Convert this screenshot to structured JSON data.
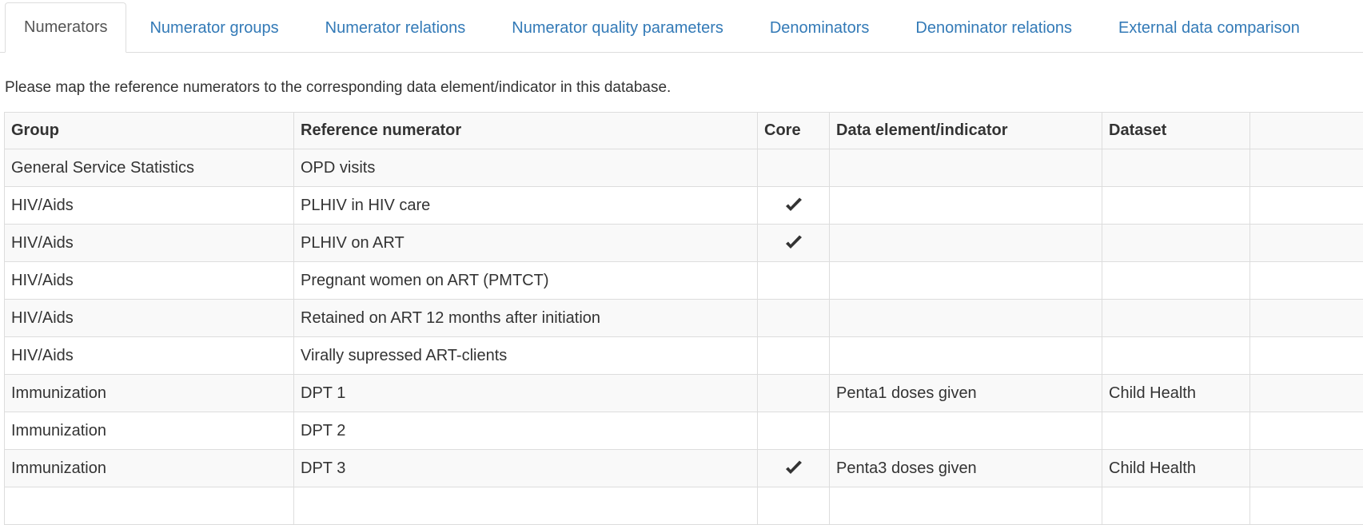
{
  "tabs": [
    {
      "label": "Numerators",
      "active": true
    },
    {
      "label": "Numerator groups",
      "active": false
    },
    {
      "label": "Numerator relations",
      "active": false
    },
    {
      "label": "Numerator quality parameters",
      "active": false
    },
    {
      "label": "Denominators",
      "active": false
    },
    {
      "label": "Denominator relations",
      "active": false
    },
    {
      "label": "External data comparison",
      "active": false
    }
  ],
  "instructions": "Please map the reference numerators to the corresponding data element/indicator in this database.",
  "table": {
    "headers": {
      "group": "Group",
      "reference": "Reference numerator",
      "core": "Core",
      "data_element": "Data element/indicator",
      "dataset": "Dataset"
    },
    "rows": [
      {
        "group": "General Service Statistics",
        "reference": "OPD visits",
        "core": false,
        "data_element": "",
        "dataset": ""
      },
      {
        "group": "HIV/Aids",
        "reference": "PLHIV in HIV care",
        "core": true,
        "data_element": "",
        "dataset": ""
      },
      {
        "group": "HIV/Aids",
        "reference": "PLHIV on ART",
        "core": true,
        "data_element": "",
        "dataset": ""
      },
      {
        "group": "HIV/Aids",
        "reference": "Pregnant women on ART (PMTCT)",
        "core": false,
        "data_element": "",
        "dataset": ""
      },
      {
        "group": "HIV/Aids",
        "reference": "Retained on ART 12 months after initiation",
        "core": false,
        "data_element": "",
        "dataset": ""
      },
      {
        "group": "HIV/Aids",
        "reference": "Virally supressed ART-clients",
        "core": false,
        "data_element": "",
        "dataset": ""
      },
      {
        "group": "Immunization",
        "reference": "DPT 1",
        "core": false,
        "data_element": "Penta1 doses given",
        "dataset": "Child Health"
      },
      {
        "group": "Immunization",
        "reference": "DPT 2",
        "core": false,
        "data_element": "",
        "dataset": ""
      },
      {
        "group": "Immunization",
        "reference": "DPT 3",
        "core": true,
        "data_element": "Penta3 doses given",
        "dataset": "Child Health"
      },
      {
        "group": "",
        "reference": "",
        "core": false,
        "data_element": "",
        "dataset": ""
      }
    ]
  },
  "icons": {
    "core_check": "check-icon"
  },
  "colors": {
    "link": "#337ab7",
    "border": "#dddddd",
    "stripe": "#f9f9f9",
    "text": "#333333"
  }
}
